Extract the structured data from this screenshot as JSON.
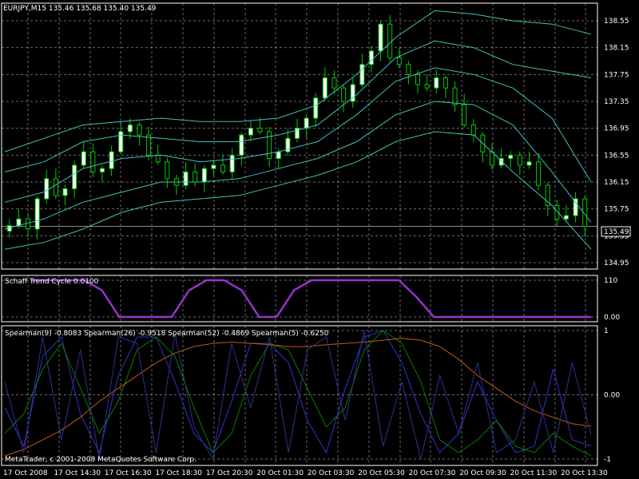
{
  "chart_title": "EURJPY,M15  135.46 135.68 135.40 135.49",
  "price_label": "135.49",
  "copyright": "MetaTrader, c 2001-2008 MetaQuotes Software Corp.",
  "colors": {
    "background": "#000000",
    "grid": "#c0c0c0",
    "axis": "#ffffff",
    "bull_candle": "#ffffff",
    "bear_candle": "#000000",
    "wick": "#00cc00",
    "bands": "#40c0c0",
    "stc": "#9932cc",
    "spearman9": "#3333cc",
    "spearman26": "#008000",
    "spearman52": "#c05a10",
    "spearman5": "#303090"
  },
  "chart_data": [
    {
      "type": "candlestick",
      "symbol": "EURJPY",
      "timeframe": "M15",
      "title": "EURJPY,M15  135.46 135.68 135.40 135.49",
      "ylim": [
        134.95,
        138.55
      ],
      "y_ticks": [
        "138.55",
        "138.15",
        "137.75",
        "137.35",
        "136.95",
        "136.55",
        "136.15",
        "135.75",
        "135.35",
        "134.95"
      ],
      "x_ticks": [
        "17 Oct 2008",
        "17 Oct 14:30",
        "17 Oct 16:30",
        "17 Oct 18:30",
        "17 Oct 20:30",
        "20 Oct 01:30",
        "20 Oct 03:30",
        "20 Oct 05:30",
        "20 Oct 07:30",
        "20 Oct 09:30",
        "20 Oct 11:30",
        "20 Oct 13:30"
      ],
      "last_price": 135.49,
      "close_path": [
        135.5,
        135.6,
        135.45,
        135.9,
        136.2,
        135.95,
        136.05,
        136.4,
        136.6,
        136.3,
        136.35,
        136.6,
        136.9,
        137.0,
        136.85,
        136.55,
        136.45,
        136.2,
        136.1,
        136.3,
        136.15,
        136.35,
        136.4,
        136.3,
        136.55,
        136.85,
        136.95,
        136.9,
        136.5,
        136.6,
        136.8,
        136.95,
        137.1,
        137.4,
        137.7,
        137.55,
        137.35,
        137.6,
        137.9,
        138.1,
        138.5,
        138.0,
        137.9,
        137.75,
        137.6,
        137.55,
        137.7,
        137.55,
        137.3,
        137.0,
        136.85,
        136.6,
        136.4,
        136.5,
        136.55,
        136.4,
        136.45,
        136.1,
        135.8,
        135.6,
        135.65,
        135.9,
        135.49
      ],
      "bands": [
        {
          "name": "upper-outer",
          "values": [
            136.6,
            136.8,
            137.0,
            137.05,
            137.1,
            137.05,
            137.05,
            137.1,
            137.3,
            137.75,
            138.3,
            138.7,
            138.65,
            138.55,
            138.5,
            138.35
          ]
        },
        {
          "name": "upper-inner",
          "values": [
            136.3,
            136.45,
            136.75,
            136.85,
            136.8,
            136.75,
            136.75,
            136.85,
            137.0,
            137.45,
            138.0,
            138.25,
            138.15,
            137.9,
            137.8,
            137.7
          ]
        },
        {
          "name": "middle",
          "values": [
            135.85,
            136.0,
            136.35,
            136.5,
            136.55,
            136.45,
            136.5,
            136.6,
            136.75,
            137.15,
            137.65,
            137.85,
            137.75,
            137.55,
            137.1,
            136.15
          ]
        },
        {
          "name": "lower-inner",
          "values": [
            135.45,
            135.6,
            135.85,
            136.0,
            136.15,
            136.15,
            136.2,
            136.35,
            136.5,
            136.75,
            137.15,
            137.35,
            137.3,
            137.0,
            136.3,
            135.55
          ]
        },
        {
          "name": "lower-outer",
          "values": [
            135.15,
            135.25,
            135.45,
            135.7,
            135.85,
            135.9,
            135.95,
            136.1,
            136.25,
            136.45,
            136.75,
            136.9,
            136.85,
            136.3,
            135.8,
            135.15
          ]
        }
      ]
    },
    {
      "type": "line",
      "title": "Schaff Trend Cycle 0.0100",
      "ylim": [
        0,
        110
      ],
      "y_ticks": [
        "110",
        "0.00"
      ],
      "series": [
        {
          "name": "Schaff Trend Cycle",
          "values": [
            110,
            110,
            110,
            110,
            80,
            0,
            0,
            0,
            0,
            80,
            110,
            110,
            80,
            0,
            0,
            80,
            110,
            110,
            110,
            110,
            110,
            110,
            60,
            0,
            0,
            0,
            0,
            0,
            0,
            0,
            0,
            0,
            0
          ]
        }
      ]
    },
    {
      "type": "line",
      "title": "Spearman(9) -0.8083  Spearman(26) -0.9518  Spearman(52) -0.4869  Spearman(5) -0.6250",
      "ylim": [
        -1,
        1
      ],
      "y_ticks": [
        "1",
        "0.00",
        "-1"
      ],
      "series": [
        {
          "name": "Spearman(9)",
          "value": -0.8083,
          "values": [
            -0.2,
            -0.8,
            0.6,
            0.9,
            -0.3,
            -0.9,
            0.3,
            0.9,
            0.9,
            0.2,
            -0.6,
            -0.9,
            -0.1,
            0.8,
            0.8,
            0.5,
            -0.4,
            -0.9,
            0.1,
            0.9,
            1.0,
            0.5,
            -0.3,
            -0.9,
            -0.6,
            0.2,
            -0.4,
            -0.9,
            -0.8,
            0.4,
            -0.7,
            -0.8
          ]
        },
        {
          "name": "Spearman(26)",
          "value": -0.9518,
          "values": [
            -0.6,
            -0.3,
            0.4,
            0.8,
            0.1,
            -0.6,
            -0.1,
            0.7,
            0.9,
            0.6,
            -0.2,
            -0.9,
            -0.6,
            0.3,
            0.8,
            0.7,
            0.1,
            -0.5,
            -0.2,
            0.7,
            1.0,
            0.8,
            0.2,
            -0.7,
            -0.9,
            -0.7,
            -0.4,
            -0.8,
            -0.9,
            -0.6,
            -0.8,
            -0.95
          ]
        },
        {
          "name": "Spearman(52)",
          "value": -0.4869,
          "values": [
            -0.95,
            -0.85,
            -0.7,
            -0.55,
            -0.35,
            -0.1,
            0.1,
            0.3,
            0.5,
            0.65,
            0.75,
            0.8,
            0.82,
            0.8,
            0.78,
            0.75,
            0.75,
            0.78,
            0.8,
            0.82,
            0.85,
            0.88,
            0.85,
            0.75,
            0.55,
            0.3,
            0.1,
            -0.1,
            -0.25,
            -0.35,
            -0.45,
            -0.49
          ]
        },
        {
          "name": "Spearman(5)",
          "value": -0.625,
          "values": [
            0.2,
            -0.9,
            0.9,
            -0.7,
            0.7,
            -1.0,
            0.9,
            0.8,
            -0.9,
            0.95,
            -0.5,
            -1.0,
            0.8,
            -0.2,
            0.9,
            -0.9,
            0.7,
            0.9,
            -0.4,
            1.0,
            -0.8,
            0.2,
            -1.0,
            0.3,
            -0.6,
            0.5,
            -0.9,
            -0.7,
            0.2,
            -0.9,
            0.5,
            -0.625
          ]
        }
      ]
    }
  ]
}
